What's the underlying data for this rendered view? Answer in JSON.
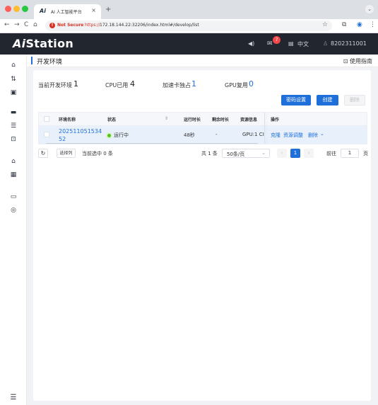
{
  "browser": {
    "tab_title": "AI 人工智能平台",
    "tab_favicon": "Ai",
    "tab_close": "×",
    "new_tab": "+",
    "tab_menu": "⌄",
    "not_secure": "Not Secure",
    "protocol": "https://",
    "url_rest": "172.18.144.22:32206/index.html#/develop/list",
    "warning_glyph": "!"
  },
  "header": {
    "logo_prefix": "Ai",
    "logo_rest": "Station",
    "sound_icon": "◀)",
    "mail_badge": "7",
    "lang_label": "中文",
    "user_id": "8202311001"
  },
  "page": {
    "title": "开发环境",
    "guide_label": "使用指南"
  },
  "stats": {
    "current_env_label": "当前开发环境",
    "current_env_value": "1",
    "cpu_label": "CPU已用",
    "cpu_value": "4",
    "accel_label": "加速卡独占",
    "accel_value": "1",
    "gpu_reuse_label": "GPU复用",
    "gpu_reuse_value": "0"
  },
  "toolbar": {
    "password_btn": "密码设置",
    "create_btn": "创建",
    "delete_btn": "删除"
  },
  "table": {
    "columns": {
      "name": "环境名称",
      "status": "状态",
      "runtime": "运行时长",
      "remaining": "剩余时长",
      "resource": "资源信息",
      "ops": "操作"
    },
    "rows": [
      {
        "name_line1": "202511051534",
        "name_line2": "52",
        "status": "运行中",
        "runtime": "48秒",
        "remaining": "-",
        "resource": "GPU:1  CI",
        "op_clone": "克隆",
        "op_adjust": "资源调整",
        "op_delete": "删除"
      }
    ]
  },
  "footer": {
    "refresh_icon": "↻",
    "select_cols": "选择列",
    "selected_text": "当前选中 0 条",
    "total_text": "共 1 条",
    "page_size": "50条/页",
    "prev": "‹",
    "current_page": "1",
    "next": "›",
    "goto_label": "前往",
    "goto_value": "1",
    "page_unit": "页"
  },
  "colors": {
    "primary": "#1e6fd9",
    "header_bg": "#22262e",
    "running": "#52c41a",
    "badge": "#f24a4a"
  }
}
